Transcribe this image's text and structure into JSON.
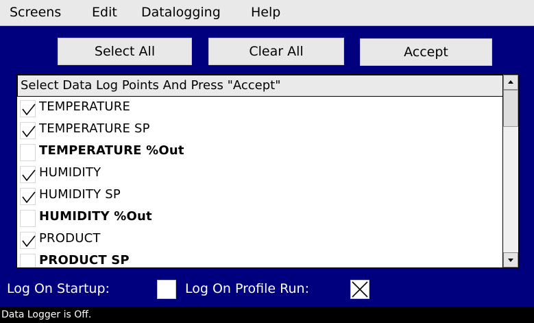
{
  "menu": {
    "items": [
      "Screens",
      "Edit",
      "Datalogging",
      "Help"
    ]
  },
  "toolbar": {
    "select_all": "Select All",
    "clear_all": "Clear All",
    "accept": "Accept"
  },
  "list": {
    "header": "Select Data Log Points And Press \"Accept\"",
    "items": [
      {
        "label": "TEMPERATURE",
        "checked": true
      },
      {
        "label": "TEMPERATURE SP",
        "checked": true
      },
      {
        "label": "TEMPERATURE %Out",
        "checked": false
      },
      {
        "label": "HUMIDITY",
        "checked": true
      },
      {
        "label": "HUMIDITY SP",
        "checked": true
      },
      {
        "label": "HUMIDITY %Out",
        "checked": false
      },
      {
        "label": "PRODUCT",
        "checked": true
      },
      {
        "label": "PRODUCT SP",
        "checked": false
      }
    ]
  },
  "options": {
    "log_on_startup_label": "Log On Startup:",
    "log_on_startup_checked": false,
    "log_on_profile_run_label": "Log On Profile Run:",
    "log_on_profile_run_checked": true
  },
  "status": {
    "text": "Data Logger is Off."
  },
  "colors": {
    "background": "#00007f",
    "menubar": "#e9e9e9",
    "status_bar": "#000000"
  }
}
